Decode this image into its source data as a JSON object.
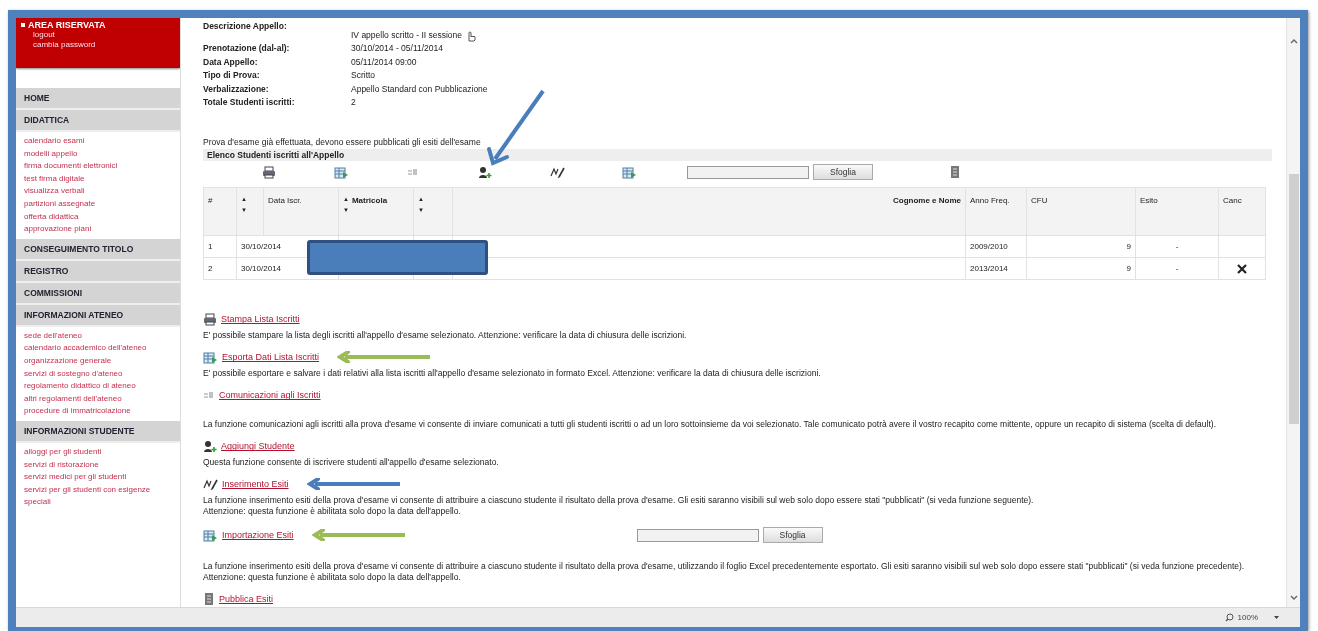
{
  "sidebar": {
    "reserved_area": {
      "title": "AREA RISERVATA",
      "links": [
        "logout",
        "cambia password"
      ]
    },
    "menu": [
      {
        "label": "HOME"
      },
      {
        "label": "DIDATTICA",
        "children": [
          {
            "label": "calendario esami"
          },
          {
            "label": "modelli appello"
          },
          {
            "label": "firma documenti elettronici"
          },
          {
            "label": "test firma digitale"
          },
          {
            "label": "visualizza verbali"
          },
          {
            "label": "partizioni assegnate"
          },
          {
            "label": "offerta didattica"
          },
          {
            "label": "approvazione piani"
          }
        ]
      },
      {
        "label": "CONSEGUIMENTO TITOLO"
      },
      {
        "label": "REGISTRO"
      },
      {
        "label": "COMMISSIONI"
      },
      {
        "label": "INFORMAZIONI ATENEO",
        "children": [
          {
            "label": "sede dell'ateneo"
          },
          {
            "label": "calendario accademico dell'ateneo"
          },
          {
            "label": "organizzazione generale"
          },
          {
            "label": "servizi di sostegno d'ateneo"
          },
          {
            "label": "regolamento didattico di ateneo"
          },
          {
            "label": "altri regolamenti dell'ateneo"
          },
          {
            "label": "procedure di immatricolazione"
          }
        ]
      },
      {
        "label": "INFORMAZIONI STUDENTE",
        "children": [
          {
            "label": "alloggi per gli studenti"
          },
          {
            "label": "servizi di ristorazione"
          },
          {
            "label": "servizi medici per gli studenti"
          },
          {
            "label": "servizi per gli studenti con esigenze speciali"
          }
        ]
      }
    ]
  },
  "details": [
    {
      "label": "Descrizione Appello:",
      "value": "IV appello scritto - II sessione",
      "kind": "description"
    },
    {
      "label": "Prenotazione (dal-al):",
      "value": "30/10/2014 - 05/11/2014",
      "kind": "plain"
    },
    {
      "label": "Data Appello:",
      "value": "05/11/2014 09:00",
      "kind": "plain"
    },
    {
      "label": "Tipo di Prova:",
      "value": "Scritto",
      "kind": "plain"
    },
    {
      "label": "Verbalizzazione:",
      "value": "Appello Standard con Pubblicazione",
      "kind": "plain"
    },
    {
      "label": "Totale Studenti iscritti:",
      "value": "2",
      "kind": "plain"
    }
  ],
  "notice": "Prova d'esame già effettuata, devono essere pubblicati gli esiti dell'esame",
  "students": {
    "title": "Elenco Studenti iscritti all'Appello",
    "toolbar": [
      {
        "kind": "print"
      },
      {
        "kind": "export"
      },
      {
        "kind": "message"
      },
      {
        "kind": "add-student",
        "arrow": {
          "color": "#4a7ebb"
        }
      },
      {
        "kind": "grades"
      },
      {
        "kind": "import"
      },
      {
        "kind": "file",
        "button": "Sfoglia"
      },
      {
        "kind": "publish"
      }
    ],
    "columns": [
      {
        "label": "#"
      },
      {
        "sort": [
          "▲",
          "▼"
        ]
      },
      {
        "label": "Data Iscr."
      },
      {
        "label": "Matricola",
        "sort": [
          "▲",
          "▼"
        ]
      },
      {
        "sort": [
          "▲",
          "▼"
        ]
      },
      {
        "label": "Cognome e Nome"
      },
      {
        "label": "Anno Freq."
      },
      {
        "label": "CFU"
      },
      {
        "label": "Esito"
      },
      {
        "label": "Canc"
      }
    ],
    "redacted": true,
    "rows": [
      {
        "number": "1",
        "date": "30/10/2014",
        "year": "2009/2010",
        "cfu": "9",
        "result": "-",
        "deletable": false
      },
      {
        "number": "2",
        "date": "30/10/2014",
        "year": "2013/2014",
        "cfu": "9",
        "result": "-",
        "deletable": true
      }
    ]
  },
  "functions": [
    {
      "kind": "print",
      "title": "Stampa Lista Iscritti",
      "text": "E' possibile stampare la lista degli iscritti all'appello d'esame selezionato. Attenzione: verificare la data di chiusura delle iscrizioni."
    },
    {
      "kind": "export",
      "title": "Esporta Dati Lista Iscritti",
      "arrow": {
        "color": "#9bbb59"
      },
      "text": "E' possibile esportare e salvare i dati relativi alla lista iscritti all'appello d'esame selezionato in formato Excel. Attenzione: verificare la data di chiusura delle iscrizioni."
    },
    {
      "kind": "message",
      "title": "Comunicazioni agli Iscritti",
      "text": "La funzione comunicazioni agli iscritti alla prova d'esame vi consente di inviare comunicati a tutti gli studenti iscritti o ad un loro sottoinsieme da voi selezionato. Tale comunicato potrà avere il vostro recapito come mittente, oppure un recapito di sistema (scelta di default)."
    },
    {
      "kind": "add-student",
      "title": "Aggiungi Studente",
      "text": "Questa funzione consente di iscrivere studenti all'appello d'esame selezionato."
    },
    {
      "kind": "grades",
      "title": "Inserimento Esiti",
      "arrow": {
        "color": "#4a7ebb"
      },
      "text": "La funzione inserimento esiti della prova d'esame vi consente di attribuire a ciascuno studente il risultato della prova d'esame. Gli esiti saranno visibili sul web solo dopo essere stati \"pubblicati\" (si veda funzione seguente).\nAttenzione: questa funzione è abilitata solo dopo la data dell'appello."
    },
    {
      "kind": "import",
      "title": "Importazione Esiti",
      "arrow": {
        "color": "#9bbb59"
      },
      "file_button": "Sfoglia",
      "text": "La funzione inserimento esiti della prova d'esame vi consente di attribuire a ciascuno studente il risultato della prova d'esame, utilizzando il foglio Excel precedentemente esportato. Gli esiti saranno visibili sul web solo dopo essere stati \"pubblicati\" (si veda funzione precedente). Attenzione: questa funzione è abilitata solo dopo la data dell'appello."
    },
    {
      "kind": "publish",
      "title": "Pubblica Esiti"
    }
  ],
  "status_bar": {
    "zoom": "100%"
  }
}
